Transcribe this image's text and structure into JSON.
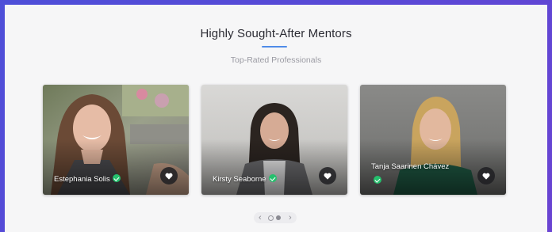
{
  "section": {
    "title": "Highly Sought-After Mentors",
    "subtitle": "Top-Rated Professionals"
  },
  "mentors": [
    {
      "name": "Estephania Solis",
      "verified": true,
      "icon": "heart-icon"
    },
    {
      "name": "Kirsty Seaborne",
      "verified": true,
      "icon": "heart-icon"
    },
    {
      "name": "Tanja Saarinen Chávez",
      "verified": true,
      "icon": "heart-icon"
    }
  ],
  "carousel": {
    "total_pages": 2,
    "current_page": 2,
    "prev_icon": "chevron-left-icon",
    "next_icon": "chevron-right-icon"
  },
  "colors": {
    "background": "#5a48d6",
    "accent": "#4f8be8",
    "verified": "#25c06d"
  }
}
